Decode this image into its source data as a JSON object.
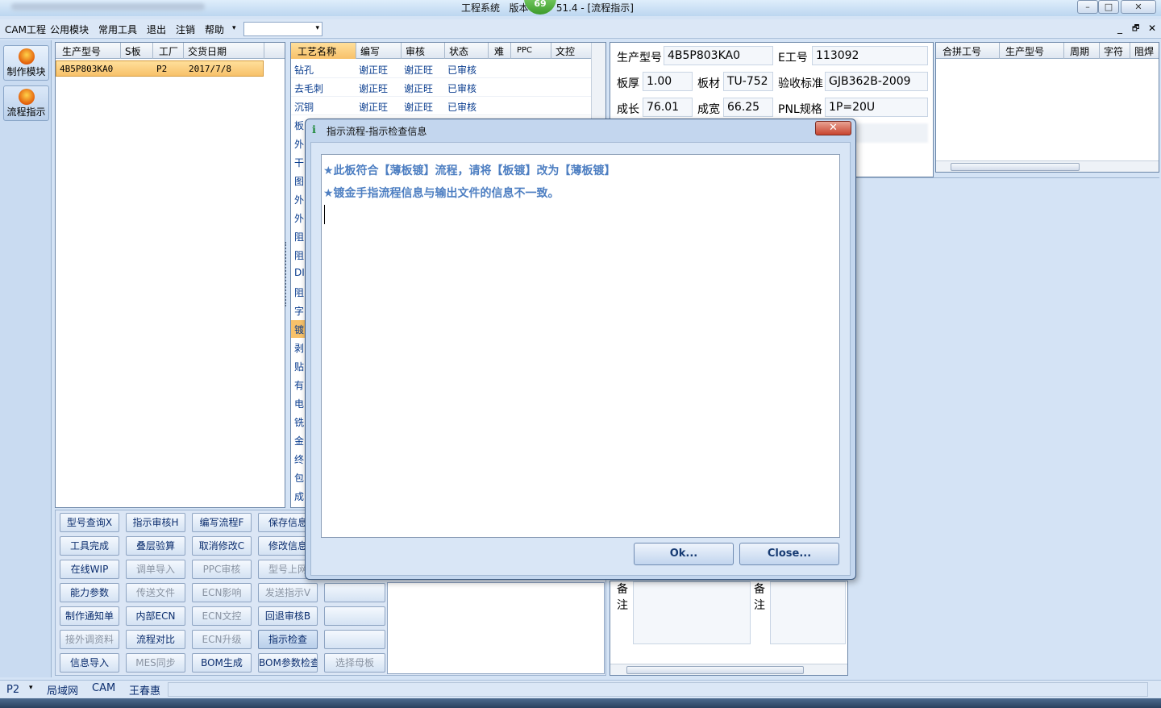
{
  "window": {
    "title_left": "工程系统",
    "title_mid": "版本",
    "title_right": "51.4 - [流程指示]",
    "badge": "69",
    "minimize": "–",
    "maximize": "□",
    "close": "✕"
  },
  "menu": {
    "items": [
      "CAM工程",
      "公用模块",
      "常用工具",
      "退出",
      "注销",
      "帮助"
    ],
    "help_arrow": "▾",
    "combo_value": "",
    "combo_arrow": "▾",
    "mdi_min": "_",
    "mdi_restore": "🗗",
    "mdi_close": "✕"
  },
  "sidebar": [
    {
      "label": "制作模块",
      "icon": "fire-icon"
    },
    {
      "label": "流程指示",
      "icon": "pause-flame-icon"
    }
  ],
  "order_grid": {
    "headers": [
      "生产型号",
      "S板",
      "工厂",
      "交货日期"
    ],
    "rows": [
      {
        "model": "4B5P803KA0",
        "s": "",
        "factory": "P2",
        "date": "2017/7/8"
      }
    ]
  },
  "process_grid": {
    "headers": [
      "工艺名称",
      "编写",
      "审核",
      "状态",
      "难",
      "PPC",
      "文控"
    ],
    "rows": [
      {
        "name": "钻孔",
        "writer": "谢正旺",
        "reviewer": "谢正旺",
        "status": "已审核"
      },
      {
        "name": "去毛刺",
        "writer": "谢正旺",
        "reviewer": "谢正旺",
        "status": "已审核"
      },
      {
        "name": "沉铜",
        "writer": "谢正旺",
        "reviewer": "谢正旺",
        "status": "已审核"
      }
    ],
    "partial_names": [
      "板",
      "外",
      "干",
      "图",
      "外",
      "外",
      "阻",
      "阻",
      "DI",
      "阻",
      "字",
      "镀",
      "剥",
      "贴",
      "有",
      "电",
      "铣",
      "金",
      "终",
      "包",
      "成"
    ]
  },
  "info": {
    "labels": {
      "model": "生产型号",
      "eno": "E工号",
      "thickness": "板厚",
      "material": "板材",
      "standard": "验收标准",
      "length": "成长",
      "width": "成宽",
      "pnl": "PNL规格"
    },
    "values": {
      "model": "4B5P803KA0",
      "eno": "113092",
      "thickness": "1.00",
      "material": "TU-752",
      "standard": "GJB362B-2009",
      "length": "76.01",
      "width": "66.25",
      "pnl": "1P=20U"
    }
  },
  "merge_grid": {
    "headers": [
      "合拼工号",
      "生产型号",
      "周期",
      "字符",
      "阻焊"
    ]
  },
  "remarks": {
    "label1": "备注",
    "label2": "备注"
  },
  "buttons": [
    [
      "型号查询X",
      "指示审核H",
      "编写流程F",
      "保存信息"
    ],
    [
      "工具完成",
      "叠层验算",
      "取消修改C",
      "修改信息"
    ],
    [
      "在线WIP",
      "调单导入",
      "PPC审核",
      "型号上网"
    ],
    [
      "能力参数",
      "传送文件",
      "ECN影响",
      "发送指示V",
      ""
    ],
    [
      "制作通知单",
      "内部ECN",
      "ECN文控",
      "回退审核B",
      ""
    ],
    [
      "接外调资料",
      "流程对比",
      "ECN升级",
      "指示检查",
      ""
    ],
    [
      "信息导入",
      "MES同步",
      "BOM生成",
      "BOM参数检查",
      "选择母板"
    ]
  ],
  "dialog": {
    "title": "指示流程-指示检查信息",
    "close": "✕",
    "messages": [
      "★此板符合【薄板镀】流程，请将【板镀】改为【薄板镀】",
      "★镀金手指流程信息与输出文件的信息不一致。"
    ],
    "ok": "Ok...",
    "close_btn": "Close..."
  },
  "statusbar": {
    "factory": "P2",
    "items": [
      "局域网",
      "CAM",
      "王春惠"
    ]
  },
  "colors": {
    "accent": "#d59a3b",
    "message": "#4e7fc2",
    "link": "#0a3d8f"
  }
}
